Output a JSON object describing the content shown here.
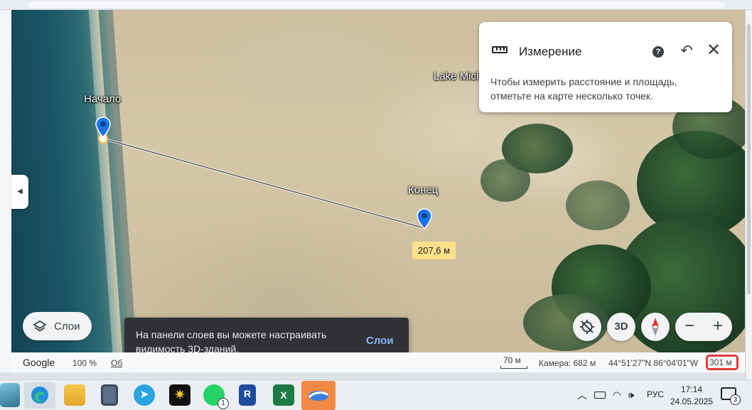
{
  "measurement_panel": {
    "title": "Измерение",
    "description": "Чтобы измерить расстояние и площадь, отметьте на карте несколько точек.",
    "help_icon": "question-icon",
    "undo_icon": "undo-icon",
    "close_icon": "close-icon"
  },
  "map": {
    "start_label": "Начало",
    "end_label": "Конец",
    "place_label": "Lake Mich",
    "distance": "207,6 м"
  },
  "controls": {
    "layers_label": "Слои",
    "three_d_label": "3D",
    "zoom_out": "−",
    "zoom_in": "+"
  },
  "toast": {
    "message": "На панели слоев вы можете настраивать видимость 3D-зданий.",
    "action": "Слои"
  },
  "status_bar": {
    "logo": "Google",
    "zoom": "100 %",
    "link_fragment": "Об",
    "scale_label": "70 м",
    "camera": "Камера: 682 м",
    "coordinates": "44°51'27\"N 86°04'01\"W",
    "scale_highlight": "301 м"
  },
  "taskbar": {
    "apps": [
      "app-icon",
      "edge-icon",
      "file-explorer-icon",
      "calculator-icon",
      "telegram-icon",
      "star-app-icon",
      "whatsapp-icon",
      "revit-icon",
      "excel-icon",
      "google-earth-icon"
    ],
    "whatsapp_badge": "1",
    "language": "РУС",
    "time": "17:14",
    "date": "24.05.2025",
    "notification_count": "3"
  },
  "colors": {
    "accent_blue": "#1a73e8",
    "distance_badge": "#ffe08a",
    "highlight_red": "#e53935",
    "toast_bg": "#303134",
    "toast_action": "#8ab4f8"
  }
}
